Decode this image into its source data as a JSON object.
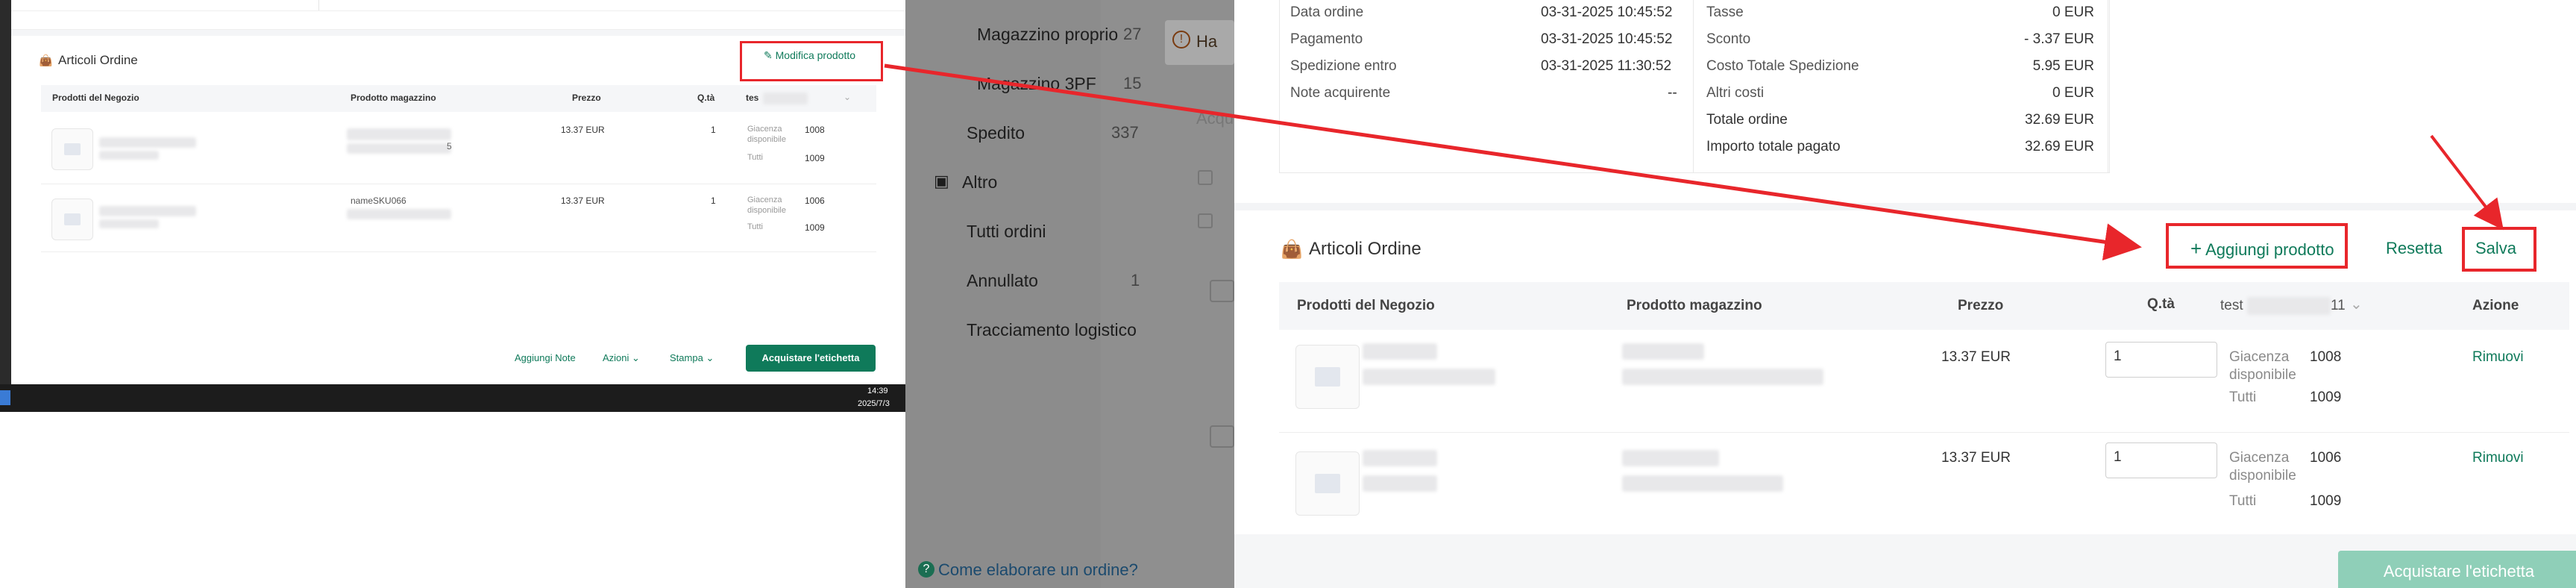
{
  "left_window": {
    "section_title": "Articoli Ordine",
    "edit_button": "Modifica prodotto",
    "columns": [
      "Prodotti del Negozio",
      "Prodotto magazzino",
      "Prezzo",
      "Q.tà",
      "tes"
    ],
    "rows": [
      {
        "store_product": "",
        "warehouse_product": "",
        "warehouse_suffix": "5",
        "price": "13.37 EUR",
        "qty": "1",
        "stock_label_1": "Giacenza",
        "stock_label_2": "disponibile",
        "stock_value": "1008",
        "total_label": "Tutti",
        "total_value": "1009"
      },
      {
        "store_product": "",
        "warehouse_product": "nameSKU066",
        "warehouse_suffix": "",
        "price": "13.37 EUR",
        "qty": "1",
        "stock_label_1": "Giacenza",
        "stock_label_2": "disponibile",
        "stock_value": "1006",
        "total_label": "Tutti",
        "total_value": "1009"
      }
    ],
    "footer": {
      "add_notes": "Aggiungi Note",
      "actions": "Azioni",
      "print": "Stampa",
      "buy_label": "Acquistare l'etichetta"
    },
    "taskbar": {
      "time": "14:39",
      "date": "2025/7/3"
    }
  },
  "middle_nav": {
    "items": [
      {
        "label": "Magazzino proprio",
        "count": "27"
      },
      {
        "label": "Magazzino 3PF",
        "count": "15"
      },
      {
        "label": "Spedito",
        "count": "337"
      }
    ],
    "section": "Altro",
    "sub_items": [
      {
        "label": "Tutti ordini",
        "count": ""
      },
      {
        "label": "Annullato",
        "count": "1"
      },
      {
        "label": "Tracciamento logistico",
        "count": ""
      }
    ],
    "tab_partial": "Ha",
    "behind_text": "Acqu",
    "help_link": "Come elaborare un ordine?"
  },
  "order_info": {
    "left_rows": [
      {
        "label": "Data ordine",
        "value": "03-31-2025 10:45:52"
      },
      {
        "label": "Pagamento",
        "value": "03-31-2025 10:45:52"
      },
      {
        "label": "Spedizione entro",
        "value": "03-31-2025 11:30:52"
      },
      {
        "label": "Note acquirente",
        "value": "--"
      }
    ],
    "right_rows": [
      {
        "label": "Tasse",
        "value": "0 EUR"
      },
      {
        "label": "Sconto",
        "value": "- 3.37 EUR"
      },
      {
        "label": "Costo Totale Spedizione",
        "value": "5.95 EUR"
      },
      {
        "label": "Altri costi",
        "value": "0 EUR"
      },
      {
        "label": "Totale ordine",
        "value": "32.69 EUR"
      },
      {
        "label": "Importo totale pagato",
        "value": "32.69 EUR"
      }
    ]
  },
  "articles": {
    "title": "Articoli Ordine",
    "add_product": "Aggiungi prodotto",
    "reset": "Resetta",
    "save": "Salva",
    "columns": {
      "store": "Prodotti del Negozio",
      "warehouse": "Prodotto magazzino",
      "price": "Prezzo",
      "qty": "Q.tà",
      "warehouse_col": "test",
      "warehouse_col_suffix": "11",
      "action": "Azione"
    },
    "rows": [
      {
        "price": "13.37 EUR",
        "qty": "1",
        "stock_label_1": "Giacenza",
        "stock_label_2": "disponibile",
        "stock_value": "1008",
        "total_label": "Tutti",
        "total_value": "1009",
        "remove": "Rimuovi"
      },
      {
        "price": "13.37 EUR",
        "qty": "1",
        "stock_label_1": "Giacenza",
        "stock_label_2": "disponibile",
        "stock_value": "1006",
        "total_label": "Tutti",
        "total_value": "1009",
        "remove": "Rimuovi"
      }
    ],
    "buy_label": "Acquistare l'etichetta"
  },
  "colors": {
    "accent": "#0f7a5a",
    "highlight": "#e8262b",
    "disabled_button": "#8fcfb8"
  }
}
